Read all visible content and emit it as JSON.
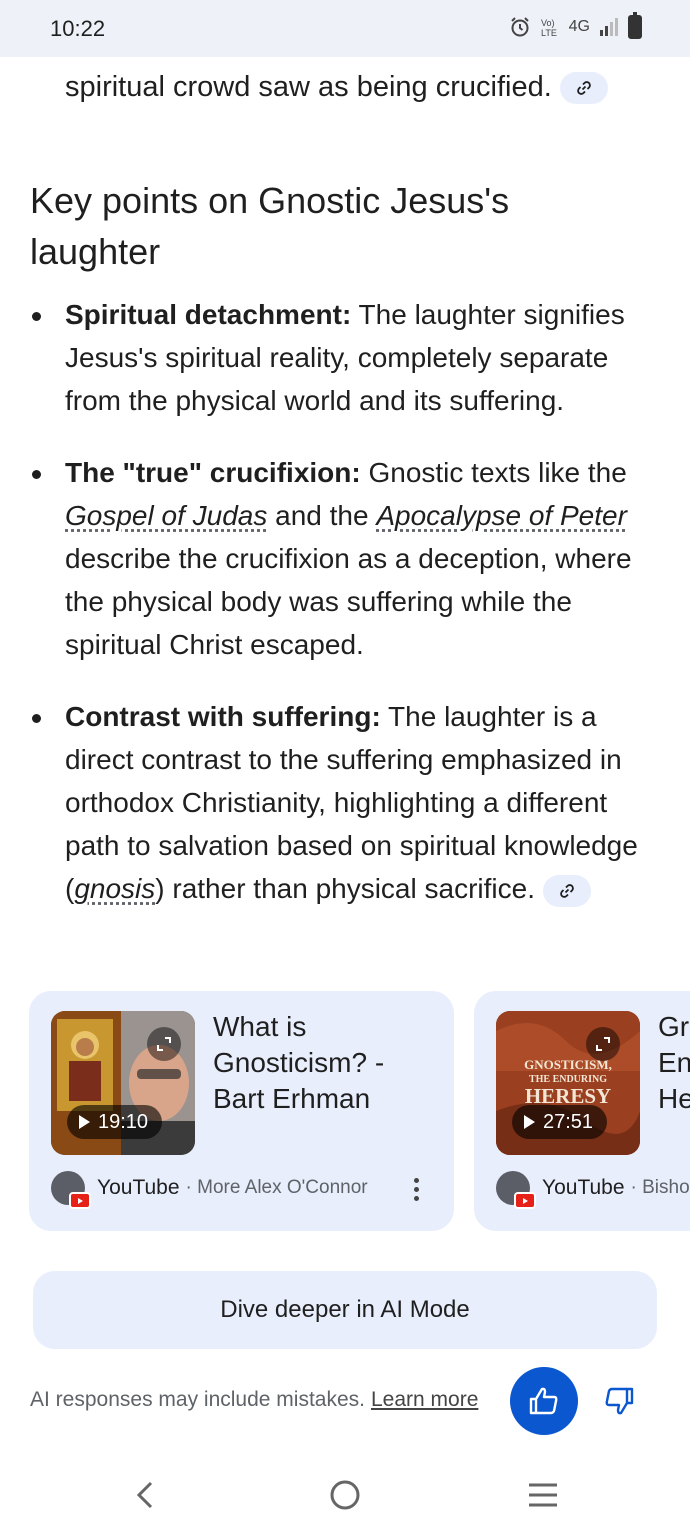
{
  "status_bar": {
    "time": "10:22",
    "network_label": "4G",
    "icons": [
      "alarm-icon",
      "volte-icon",
      "signal-icon",
      "battery-icon"
    ]
  },
  "answer": {
    "cut_line": "spiritual crowd saw as being crucified.",
    "heading": "Key points on Gnostic Jesus's laughter",
    "points": [
      {
        "term": "Spiritual detachment:",
        "text": " The laughter signifies Jesus's spiritual reality, completely separate from the physical world and its suffering."
      },
      {
        "term": "The \"true\" crucifixion:",
        "text_a": " Gnostic texts like the ",
        "ref1": "Gospel of Judas",
        "text_b": " and the ",
        "ref2": "Apocalypse of Peter",
        "text_c": " describe the crucifixion as a deception, where the physical body was suffering while the spiritual Christ escaped."
      },
      {
        "term": "Contrast with suffering:",
        "text_a": " The laughter is a direct contrast to the suffering emphasized in orthodox Christianity, highlighting a different path to salvation based on spiritual knowledge (",
        "ref": "gnosis",
        "text_b": ") rather than physical sacrifice."
      }
    ]
  },
  "videos": [
    {
      "title": "What is Gnosticism? - Bart Erhman",
      "duration": "19:10",
      "source": "YouTube",
      "channel": "· More Alex O'Connor"
    },
    {
      "title": "Gr En He",
      "duration": "27:51",
      "thumb_text_1": "GNOSTICISM,",
      "thumb_text_2": "THE ENDURING",
      "thumb_text_3": "HERESY",
      "source": "YouTube",
      "channel": "· Bisho"
    }
  ],
  "footer": {
    "dive_label": "Dive deeper in AI Mode",
    "disclaimer": "AI responses may include mistakes.",
    "learn_more": "Learn more"
  },
  "colors": {
    "accent": "#0b57d0",
    "chip_bg": "#e8eefc",
    "text": "#1f1f1f",
    "muted": "#5f6368"
  }
}
